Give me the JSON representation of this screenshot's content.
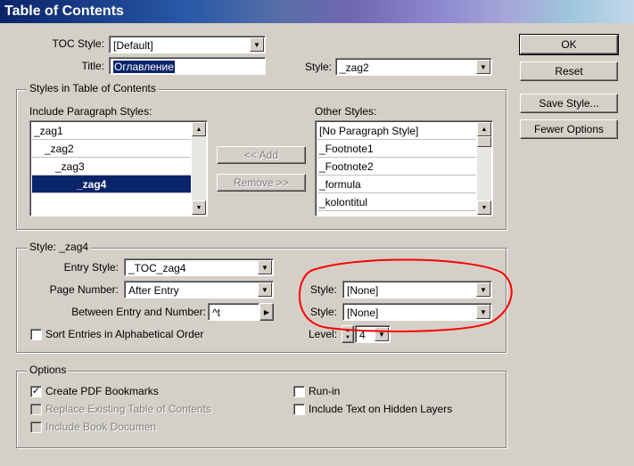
{
  "window": {
    "title": "Table of Contents"
  },
  "toc_style": {
    "label": "TOC Style:",
    "value": "[Default]"
  },
  "title_field": {
    "label": "Title:",
    "value": "Оглавление"
  },
  "title_style": {
    "label": "Style:",
    "value": "_zag2"
  },
  "buttons": {
    "ok": "OK",
    "reset": "Reset",
    "save_style": "Save Style...",
    "fewer_options": "Fewer Options",
    "add": "<< Add",
    "remove": "Remove >>"
  },
  "styles_group": {
    "label": "Styles in Table of Contents",
    "include_label": "Include Paragraph Styles:",
    "include_items": [
      "_zag1",
      "_zag2",
      "_zag3",
      "_zag4"
    ],
    "other_label": "Other Styles:",
    "other_items": [
      "[No Paragraph Style]",
      "_Footnote1",
      "_Footnote2",
      "_formula",
      "_kolontitul"
    ]
  },
  "style_group": {
    "label": "Style: _zag4",
    "entry_style": {
      "label": "Entry Style:",
      "value": "_TOC_zag4"
    },
    "page_number": {
      "label": "Page Number:",
      "value": "After Entry"
    },
    "between": {
      "label": "Between Entry and Number:",
      "value": "^t"
    },
    "style1": {
      "label": "Style:",
      "value": "[None]"
    },
    "style2": {
      "label": "Style:",
      "value": "[None]"
    },
    "sort": {
      "label": "Sort Entries in Alphabetical Order",
      "checked": false
    },
    "level": {
      "label": "Level:",
      "value": "4"
    }
  },
  "options_group": {
    "label": "Options",
    "create_pdf": {
      "label": "Create PDF Bookmarks",
      "checked": true
    },
    "replace_existing": {
      "label": "Replace Existing Table of Contents",
      "checked": false
    },
    "include_book": {
      "label": "Include Book Documen",
      "checked": false
    },
    "run_in": {
      "label": "Run-in",
      "checked": false
    },
    "hidden_layers": {
      "label": "Include Text on Hidden Layers",
      "checked": false
    }
  },
  "colors": {
    "accent": "#0a246a",
    "annotation": "#ff0000"
  },
  "icons": {
    "dropdown": "chevron-down-icon",
    "scroll_up": "arrow-up-icon",
    "scroll_down": "arrow-down-icon",
    "checkmark": "check-icon"
  }
}
